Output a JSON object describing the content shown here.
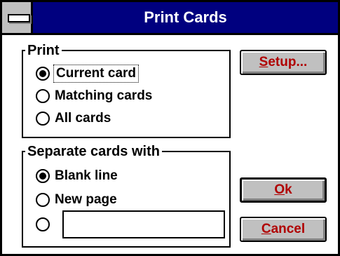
{
  "window": {
    "title": "Print Cards"
  },
  "print_group": {
    "legend": "Print",
    "options": [
      {
        "label": "Current card",
        "selected": true
      },
      {
        "label": "Matching cards",
        "selected": false
      },
      {
        "label": "All cards",
        "selected": false
      }
    ]
  },
  "separate_group": {
    "legend": "Separate cards with",
    "options": [
      {
        "label": "Blank line",
        "selected": true
      },
      {
        "label": "New page",
        "selected": false
      }
    ],
    "custom_option": {
      "selected": false,
      "value": ""
    }
  },
  "buttons": {
    "setup": {
      "mnemonic": "S",
      "rest": "etup..."
    },
    "ok": {
      "mnemonic": "O",
      "rest": "k"
    },
    "cancel": {
      "mnemonic": "C",
      "rest": "ancel"
    }
  },
  "colors": {
    "title_bar": "#00007f",
    "button_face": "#c0c0c0",
    "button_text": "#b00000"
  },
  "icons": {
    "system_menu": "system-menu-icon",
    "radio": "radio-button"
  }
}
